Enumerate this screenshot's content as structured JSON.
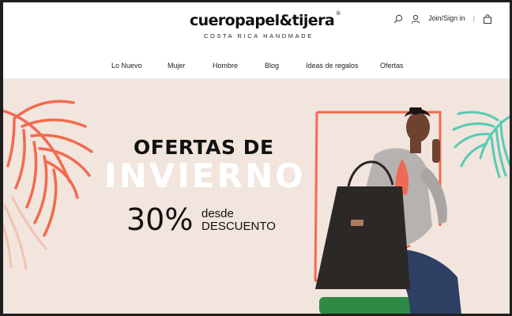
{
  "brand": {
    "logo": "cueropapel&tijera",
    "registered": "®",
    "tagline": "COSTA RICA HANDMADE"
  },
  "header": {
    "signin_label": "Join/Sign in",
    "separator": "|"
  },
  "nav": {
    "items": [
      "Lo Nuevo",
      "Mujer",
      "Hombre",
      "Blog",
      "Ideas de regalos",
      "Ofertas"
    ]
  },
  "hero": {
    "line1": "OFERTAS DE",
    "line2": "INVIERNO",
    "percent": "30%",
    "desde": "desde",
    "descuento": "DESCUENTO"
  },
  "colors": {
    "coral": "#f26a4f",
    "mint": "#57cbb3",
    "background": "#f1e5dd"
  },
  "icons": [
    "search-icon",
    "user-icon",
    "shopping-bag-icon"
  ]
}
